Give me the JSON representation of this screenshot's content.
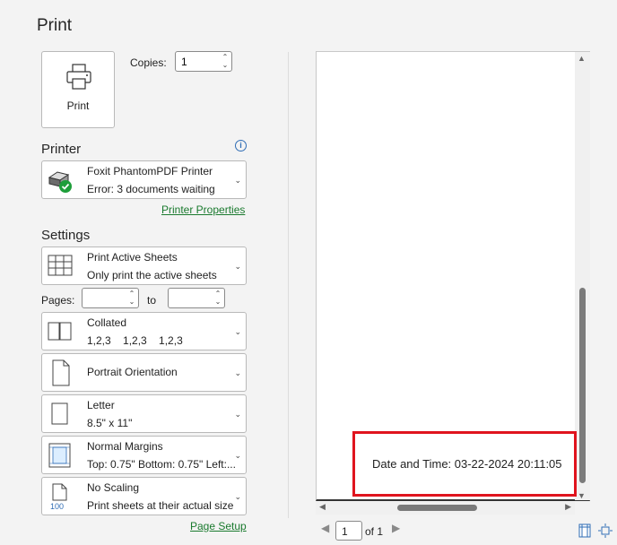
{
  "page": {
    "title": "Print"
  },
  "print_button": {
    "label": "Print"
  },
  "copies": {
    "label": "Copies:",
    "value": "1"
  },
  "printer": {
    "heading": "Printer",
    "name": "Foxit PhantomPDF Printer",
    "status": "Error: 3 documents waiting",
    "properties_link": "Printer Properties"
  },
  "settings": {
    "heading": "Settings",
    "print_what": {
      "title": "Print Active Sheets",
      "subtitle": "Only print the active sheets"
    },
    "pages": {
      "label": "Pages:",
      "to_label": "to",
      "from": "",
      "to": ""
    },
    "collation": {
      "title": "Collated",
      "subtitle": "1,2,3    1,2,3    1,2,3"
    },
    "orientation": {
      "title": "Portrait Orientation"
    },
    "paper": {
      "title": "Letter",
      "subtitle": "8.5\" x 11\""
    },
    "margins": {
      "title": "Normal Margins",
      "subtitle": "Top: 0.75\" Bottom: 0.75\" Left:..."
    },
    "scaling": {
      "title": "No Scaling",
      "subtitle": "Print sheets at their actual size",
      "icon_text": "100"
    },
    "page_setup_link": "Page Setup"
  },
  "preview": {
    "footer_text": "Date and Time: 03-22-2024 20:11:05",
    "current_page": "1",
    "of_label": "of 1"
  },
  "colors": {
    "highlight": "#e0141e",
    "link": "#1a7a2e",
    "status_ok": "#1e9e3a"
  }
}
